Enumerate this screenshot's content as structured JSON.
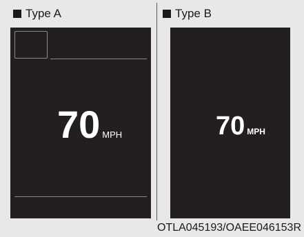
{
  "panels": {
    "type_a": {
      "label": "Type A",
      "speed_value": "70",
      "speed_unit": "MPH"
    },
    "type_b": {
      "label": "Type B",
      "speed_value": "70",
      "speed_unit": "MPH"
    }
  },
  "figure_code": "OTLA045193/OAEE046153R",
  "colors": {
    "background": "#e8e8e8",
    "screen": "#231f20",
    "text_on_screen": "#ffffff",
    "outline": "#8a8a8a"
  }
}
